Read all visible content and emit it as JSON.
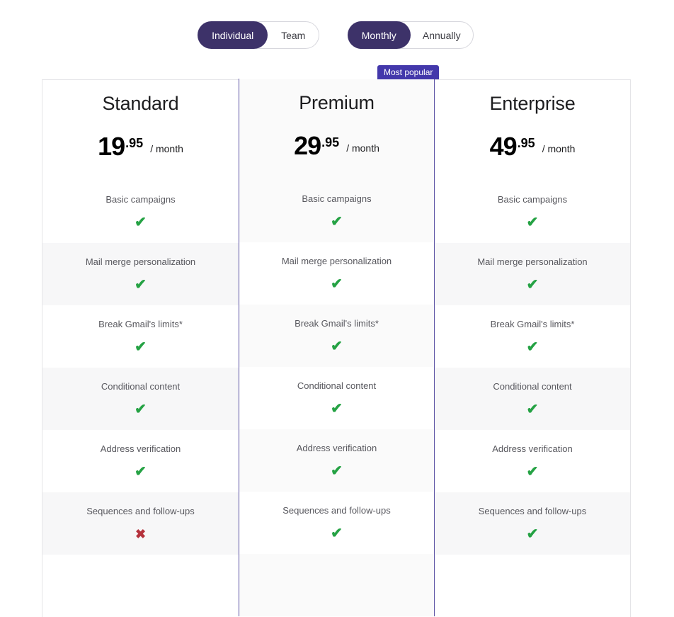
{
  "toggles": [
    {
      "name": "audience",
      "options": [
        {
          "label": "Individual",
          "active": true
        },
        {
          "label": "Team",
          "active": false
        }
      ]
    },
    {
      "name": "billing-period",
      "options": [
        {
          "label": "Monthly",
          "active": true
        },
        {
          "label": "Annually",
          "active": false
        }
      ]
    }
  ],
  "badge": {
    "label": "Most popular"
  },
  "colors": {
    "toggle_active": "#3d3269",
    "badge": "#4338ab",
    "premium_border": "#5b52a3",
    "check": "#25a244",
    "cross": "#b5323c"
  },
  "icons": {
    "check": "✔",
    "cross": "✖"
  },
  "plans": [
    {
      "name": "Standard",
      "price_int": "19",
      "price_cents": ".95",
      "price_period": "/ month",
      "highlighted": false,
      "features": [
        {
          "label": "Basic campaigns",
          "included": true
        },
        {
          "label": "Mail merge personalization",
          "included": true
        },
        {
          "label": "Break Gmail's limits*",
          "included": true
        },
        {
          "label": "Conditional content",
          "included": true
        },
        {
          "label": "Address verification",
          "included": true
        },
        {
          "label": "Sequences and follow-ups",
          "included": false
        }
      ]
    },
    {
      "name": "Premium",
      "price_int": "29",
      "price_cents": ".95",
      "price_period": "/ month",
      "highlighted": true,
      "features": [
        {
          "label": "Basic campaigns",
          "included": true
        },
        {
          "label": "Mail merge personalization",
          "included": true
        },
        {
          "label": "Break Gmail's limits*",
          "included": true
        },
        {
          "label": "Conditional content",
          "included": true
        },
        {
          "label": "Address verification",
          "included": true
        },
        {
          "label": "Sequences and follow-ups",
          "included": true
        }
      ]
    },
    {
      "name": "Enterprise",
      "price_int": "49",
      "price_cents": ".95",
      "price_period": "/ month",
      "highlighted": false,
      "features": [
        {
          "label": "Basic campaigns",
          "included": true
        },
        {
          "label": "Mail merge personalization",
          "included": true
        },
        {
          "label": "Break Gmail's limits*",
          "included": true
        },
        {
          "label": "Conditional content",
          "included": true
        },
        {
          "label": "Address verification",
          "included": true
        },
        {
          "label": "Sequences and follow-ups",
          "included": true
        }
      ]
    }
  ]
}
